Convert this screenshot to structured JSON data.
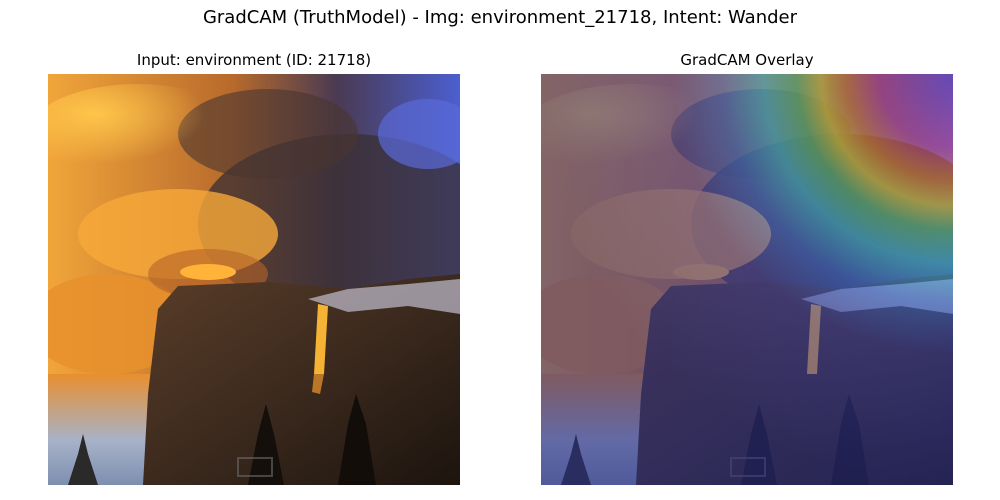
{
  "figure": {
    "title": "GradCAM (TruthModel) - Img: environment_21718, Intent: Wander"
  },
  "panels": [
    {
      "title": "Input: environment (ID: 21718)",
      "content": "input-photo"
    },
    {
      "title": "GradCAM Overlay",
      "content": "gradcam-overlay"
    }
  ],
  "colors": {
    "sky_blue": "#4f63d6",
    "cloud_orange": "#f2a43a",
    "cliff_brown": "#4a3322",
    "waterfall_glow": "#f5b335",
    "overlay_tint": "#3a3fa8"
  },
  "heatmap": {
    "colormap": "jet",
    "peak_region": "top-right"
  }
}
